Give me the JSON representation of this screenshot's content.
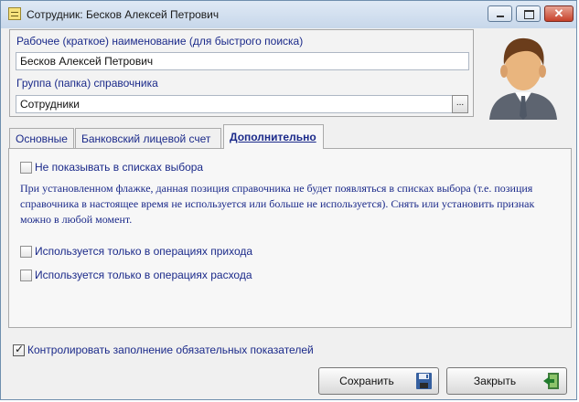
{
  "window": {
    "title": "Сотрудник: Бесков Алексей Петрович",
    "title_icon": "document-list-icon",
    "controls": [
      "minimize-icon",
      "maximize-icon",
      "close-icon"
    ]
  },
  "header": {
    "name_label": "Рабочее (краткое) наименование (для быстрого поиска)",
    "name_value": "Бесков Алексей Петрович",
    "group_label": "Группа (папка) справочника",
    "group_value": "Сотрудники",
    "browse_label": "...",
    "avatar": "employee-avatar-icon"
  },
  "tabs": [
    {
      "label": "Основные",
      "active": false
    },
    {
      "label": "Банковский лицевой счет",
      "active": false
    },
    {
      "label": "Дополнительно",
      "active": true
    }
  ],
  "additional": {
    "hide_option": {
      "label": "Не показывать в списках выбора",
      "checked": false
    },
    "note": "При установленном флажке, данная позиция справочника не будет появляться в списках выбора (т.е. позиция справочника в настоящее время не используется или больше не используется). Снять или установить признак можно в любой момент.",
    "income_option": {
      "label": "Используется только в операциях прихода",
      "checked": false
    },
    "expense_option": {
      "label": "Используется только в операциях расхода",
      "checked": false
    }
  },
  "footer": {
    "control_option": {
      "label": "Контролировать заполнение обязательных показателей",
      "checked": true
    },
    "save_label": "Сохранить",
    "close_label": "Закрыть",
    "save_icon": "save-disk-icon",
    "close_icon": "exit-door-icon"
  }
}
